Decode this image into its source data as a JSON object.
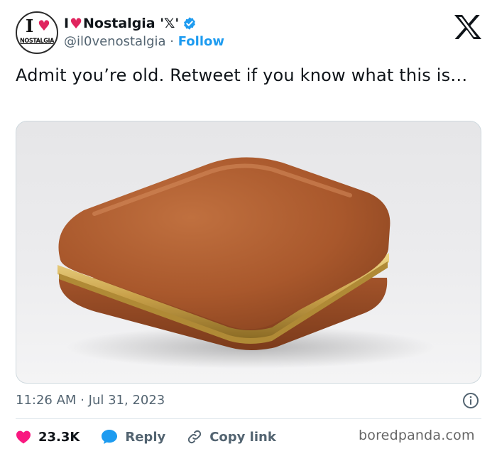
{
  "account": {
    "avatar_text_top": "I",
    "avatar_text_bottom": "NOSTALGIA",
    "name_prefix": "I",
    "name_rest": "Nostalgia '𝕏'",
    "handle": "@il0venostalgia",
    "separator": "·",
    "follow_label": "Follow",
    "verified": true
  },
  "tweet": {
    "text": "Admit you’re old. Retweet if you know what this is…",
    "time": "11:26 AM",
    "date_separator": "·",
    "date": "Jul 31, 2023"
  },
  "media": {
    "subject": "brown-leather-jewelry-box"
  },
  "actions": {
    "likes": "23.3K",
    "reply_label": "Reply",
    "copy_link_label": "Copy link"
  },
  "watermark": "boredpanda.com",
  "colors": {
    "accent": "#1d9bf0",
    "like_heart": "#f91880",
    "text_primary": "#0f1419",
    "text_secondary": "#536471"
  },
  "icons": [
    "heart-icon",
    "verified-badge-icon",
    "x-logo-icon",
    "info-icon",
    "like-heart-icon",
    "reply-bubble-icon",
    "link-icon"
  ]
}
